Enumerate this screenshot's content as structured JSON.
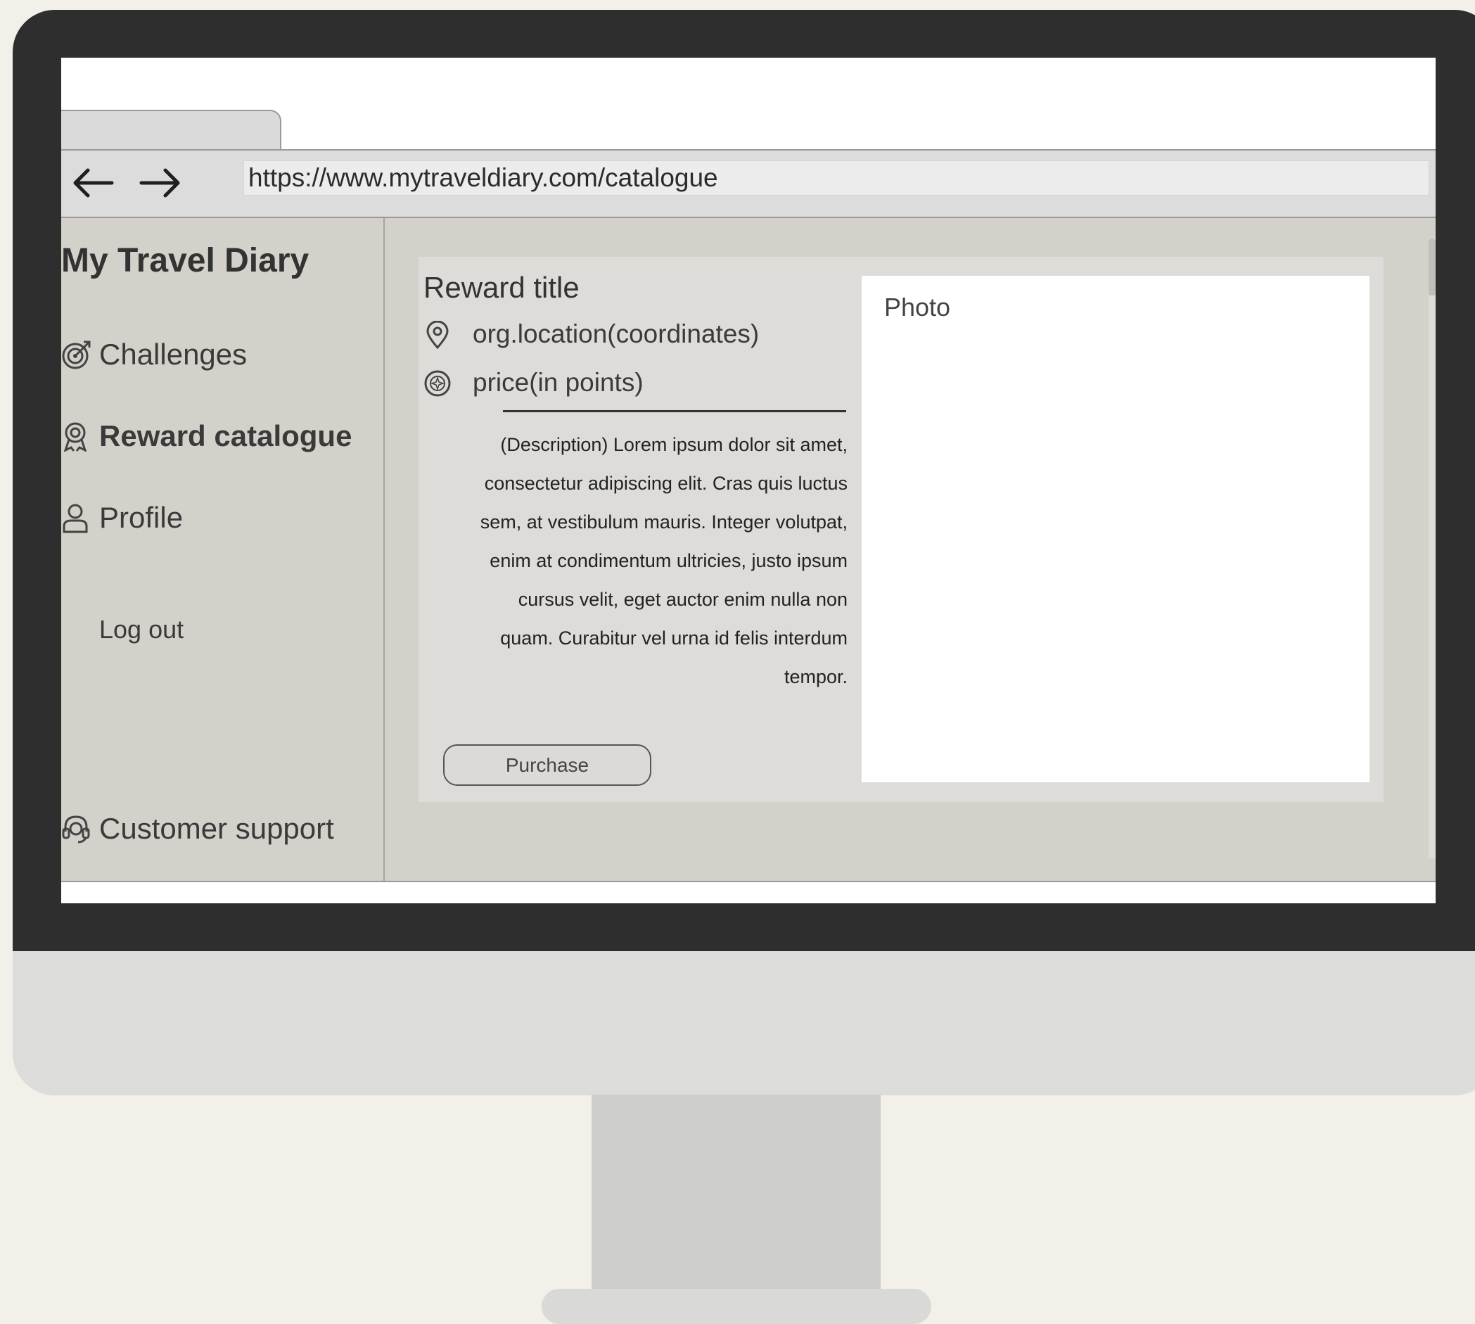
{
  "browser": {
    "url": "https://www.mytraveldiary.com/catalogue"
  },
  "sidebar": {
    "app_title": "My Travel Diary",
    "items": [
      {
        "label": "Challenges",
        "icon": "target-icon"
      },
      {
        "label": "Reward catalogue",
        "icon": "award-icon",
        "active": true
      },
      {
        "label": "Profile",
        "icon": "user-icon"
      }
    ],
    "logout_label": "Log out",
    "support": {
      "label": "Customer support",
      "icon": "headset-icon"
    }
  },
  "reward": {
    "title": "Reward title",
    "location": "org.location(coordinates)",
    "price": "price(in points)",
    "description": "(Description) Lorem ipsum dolor sit amet, consectetur adipiscing elit. Cras quis  luctus sem, at vestibulum mauris. Integer volutpat, enim at condimentum ultricies, justo ipsum cursus velit, eget auctor enim nulla non quam.  Curabitur vel urna id felis interdum tempor.",
    "purchase_label": "Purchase",
    "photo_label": "Photo"
  }
}
